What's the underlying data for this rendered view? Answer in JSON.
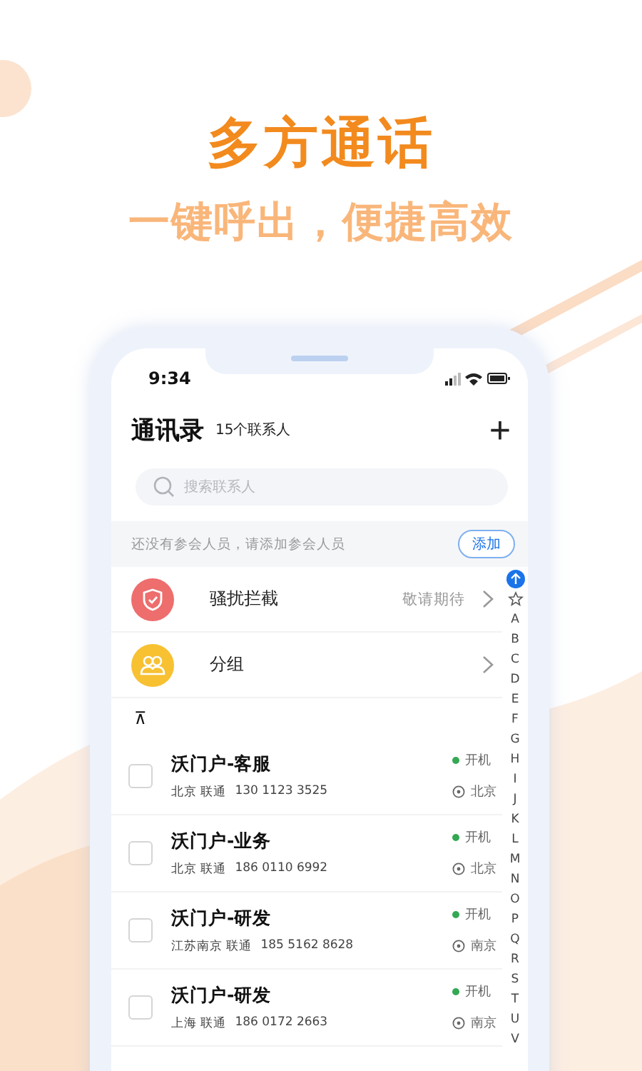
{
  "headline": "多方通话",
  "tagline": "一键呼出，便捷高效",
  "status_bar": {
    "time": "9:34"
  },
  "header": {
    "title": "通讯录",
    "count": "15个联系人",
    "add_icon": "+"
  },
  "search": {
    "placeholder": "搜索联系人"
  },
  "banner": {
    "text": "还没有参会人员，请添加参会人员",
    "button": "添加"
  },
  "menu_items": [
    {
      "kind": "shield",
      "label": "骚扰拦截",
      "hint": "敬请期待"
    },
    {
      "kind": "group",
      "label": "分组"
    }
  ],
  "top_icon": "⊼",
  "index": [
    "A",
    "B",
    "C",
    "D",
    "E",
    "F",
    "G",
    "H",
    "I",
    "J",
    "K",
    "L",
    "M",
    "N",
    "O",
    "P",
    "Q",
    "R",
    "S",
    "T",
    "U",
    "V"
  ],
  "contacts": [
    {
      "name": "沃门户-客服",
      "region": "北京 联通",
      "phone": "130 1123 3525",
      "status": "开机",
      "color": "#34a853",
      "city": "北京",
      "checked": false
    },
    {
      "name": "沃门户-业务",
      "region": "北京 联通",
      "phone": "186 0110 6992",
      "status": "开机",
      "color": "#34a853",
      "city": "北京",
      "checked": false
    },
    {
      "name": "沃门户-研发",
      "region": "江苏南京 联通",
      "phone": "185 5162 8628",
      "status": "开机",
      "color": "#34a853",
      "city": "南京",
      "checked": false
    },
    {
      "name": "沃门户-研发",
      "region": "上海 联通",
      "phone": "186 0172 2663",
      "status": "开机",
      "color": "#34a853",
      "city": "南京",
      "checked": false
    }
  ]
}
